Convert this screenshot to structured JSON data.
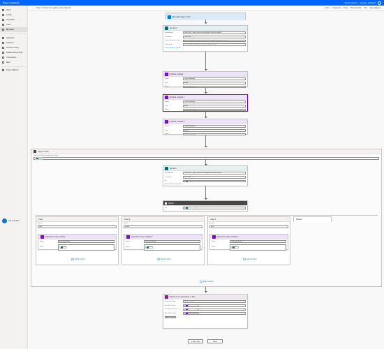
{
  "app": {
    "title": "Power Automate",
    "env_label": "Environments",
    "env_name": "Contoso (default)"
  },
  "sidebar": {
    "items": [
      {
        "label": "Home"
      },
      {
        "label": "Create"
      },
      {
        "label": "Templates"
      },
      {
        "label": "Learn"
      },
      {
        "label": "My flows"
      },
      {
        "label": "Approvals"
      },
      {
        "label": "Solutions"
      },
      {
        "label": "Process mining"
      },
      {
        "label": "Desktop flow activity"
      },
      {
        "label": "Connections"
      },
      {
        "label": "More"
      },
      {
        "label": "Power Platform"
      }
    ],
    "chatbot_label": "Ask a chatbot"
  },
  "cmdbar": {
    "back": "←",
    "crumb": "Flows > Add items to gallery via a collection",
    "undo": "Undo",
    "comments": "Comments",
    "save": "Save",
    "checker": "Flow checker",
    "test": "Test",
    "designer": "New designer"
  },
  "flow": {
    "trigger": {
      "title": "Manually trigger a flow"
    },
    "get_items": {
      "title": "Get items",
      "site_label": "Site Address",
      "site_value": "Demo site - https://contoso.sharepoint.com/sites/demo",
      "list_label": "List Name",
      "list_value": "Test Data",
      "limit_label": "Limit Columns by View",
      "limit_value": "Avoid column threshold issues by only using columns in a view",
      "top_label": "Top Count",
      "top_value": "Total number of entries to retrieve (default = all)",
      "advanced": "Show advanced options"
    },
    "init1": {
      "title": "Initialize variable",
      "name_label": "Name",
      "name_value": "TypedTextArray",
      "type_label": "Type",
      "type_value": "Array",
      "value_label": "Value",
      "value_value": "Enter initial value"
    },
    "init2": {
      "title": "Initialize variable 2",
      "name_label": "Name",
      "name_value": "TypedTextArray",
      "type_label": "Type",
      "type_value": "Array",
      "value_label": "Value",
      "value_value": "Enter initial value"
    },
    "init3": {
      "title": "Initialize variable 3",
      "name_label": "Name",
      "name_value": "TypedTextArray",
      "type_label": "Type",
      "type_value": "Array",
      "value_label": "Value",
      "value_value": "Enter initial value"
    },
    "apply": {
      "title": "Apply to each",
      "prompt": "Select an output from previous steps",
      "token": "value"
    },
    "get_item": {
      "title": "Get item",
      "site_label": "Site Address",
      "site_value": "Demo site - https://contoso.sharepoint.com/sites/demo",
      "list_label": "List Name",
      "list_value": "Test Data",
      "id_label": "Id",
      "id_token": "ID",
      "advanced": "Show advanced options"
    },
    "switch": {
      "title": "Switch",
      "on_label": "On",
      "on_token": "Type Value"
    },
    "cases": [
      {
        "title": "Case",
        "equals_label": "Equals",
        "equals_value": "Red",
        "action": "Append to array variable",
        "name_label": "Name",
        "name_value": "TypedTextArray",
        "value_label": "Value",
        "value_token": "Text",
        "add": "Add an action"
      },
      {
        "title": "Case 2",
        "equals_label": "Equals",
        "equals_value": "Green",
        "action": "Append to array variable 2",
        "name_label": "Name",
        "name_value": "TypedTextArray",
        "value_label": "Value",
        "value_token": "Text",
        "add": "Add an action"
      },
      {
        "title": "Case 3",
        "equals_label": "Equals",
        "equals_value": "Blue",
        "action": "Append to array variable 3",
        "name_label": "Name",
        "name_value": "TypedTextArray",
        "value_label": "Value",
        "value_token": "Text",
        "add": "Add an action"
      }
    ],
    "default_label": "Default",
    "add_action": "Add an action",
    "respond": {
      "title": "Respond to a PowerApp or flow",
      "output_label": "Response Body",
      "output_value": "Enter a value",
      "rows": [
        {
          "label": "Red Text Values",
          "token": "TypedTextArray"
        },
        {
          "label": "Green Text Values",
          "token": "TypedTextArray"
        },
        {
          "label": "Blue Text Values",
          "token": "TypedTextArray"
        }
      ],
      "add_output": "Add an output"
    },
    "new_step": "+ New step",
    "save": "Save"
  },
  "colors": {
    "blue": "#0066ff",
    "sharepoint": "#036c70",
    "variable": "#770bd6",
    "control": "#484644",
    "powerapps": "#742774",
    "trigger": "#0078d4"
  }
}
